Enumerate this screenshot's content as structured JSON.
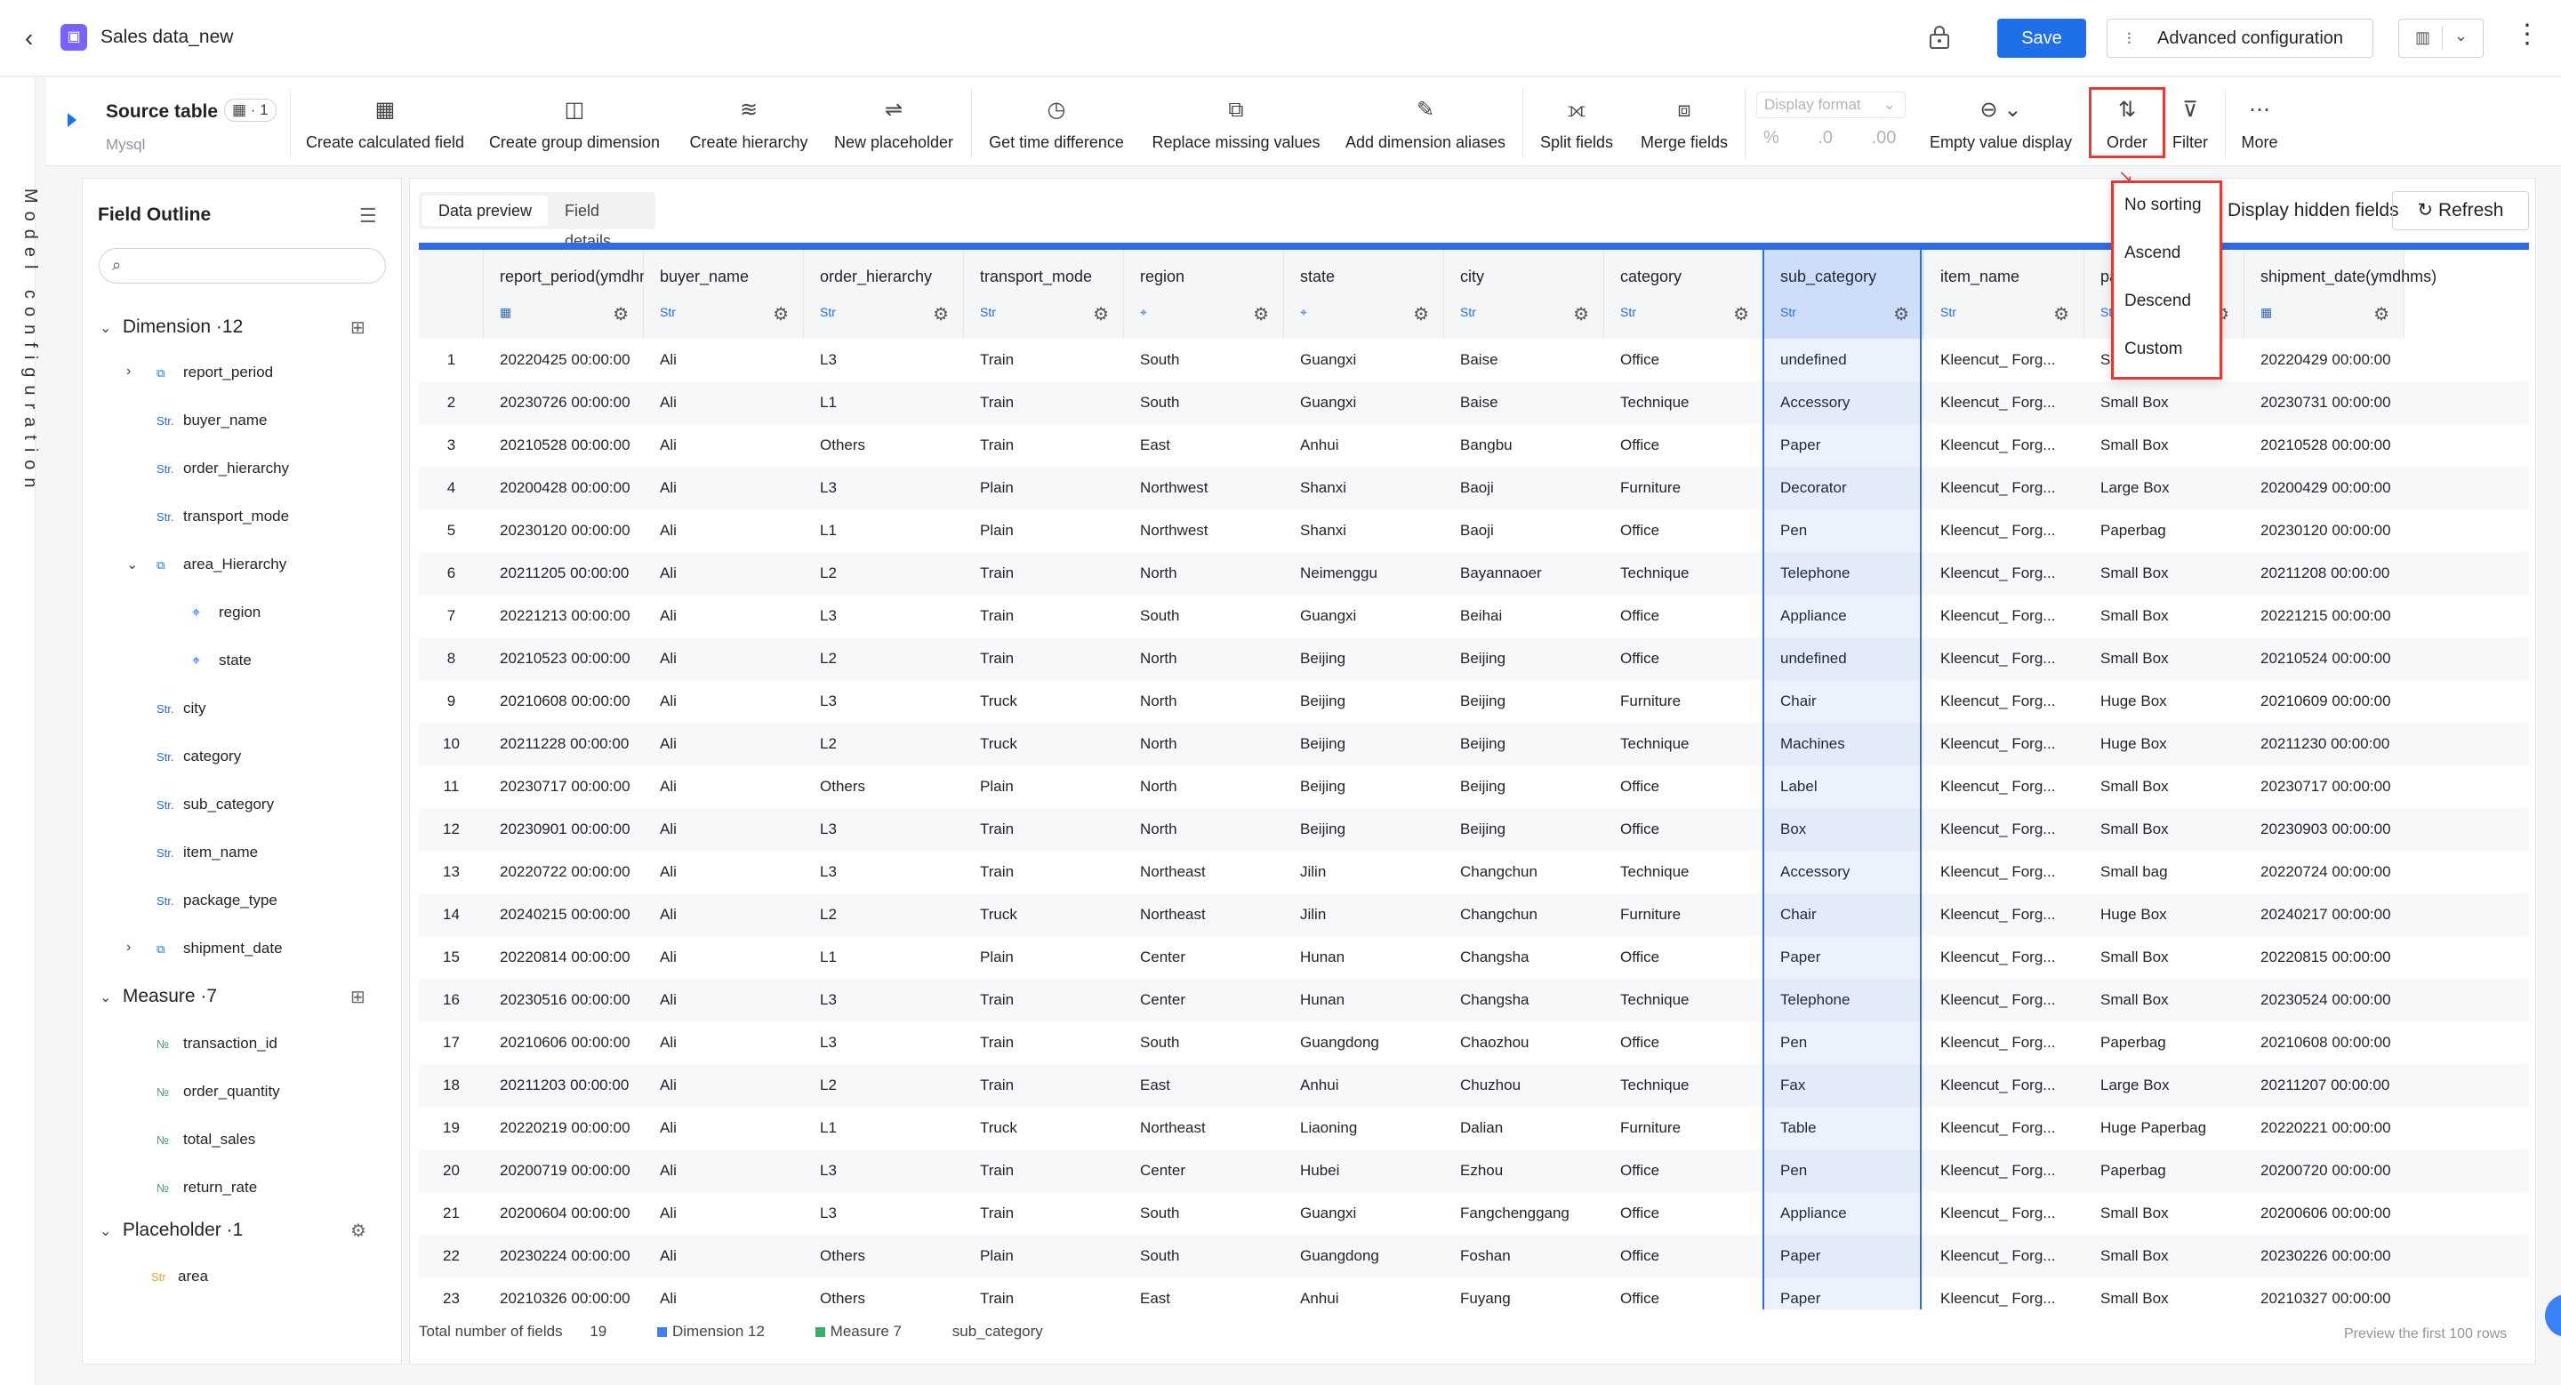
{
  "header": {
    "title": "Sales data_new",
    "save_label": "Save",
    "advanced_label": "Advanced configuration"
  },
  "rail": {
    "label": "Model configuration"
  },
  "source": {
    "title": "Source table",
    "badge": "▦ · 1",
    "db": "Mysql"
  },
  "toolbar": {
    "tools": [
      {
        "label": "Create calculated field",
        "icon": "▦"
      },
      {
        "label": "Create group dimension",
        "icon": "◫"
      },
      {
        "label": "Create hierarchy",
        "icon": "≋"
      },
      {
        "label": "New placeholder",
        "icon": "⇌"
      },
      {
        "label": "Get time difference",
        "icon": "◷"
      },
      {
        "label": "Replace missing values",
        "icon": "⧉"
      },
      {
        "label": "Add dimension aliases",
        "icon": "✎"
      },
      {
        "label": "Split fields",
        "icon": "⟗"
      },
      {
        "label": "Merge fields",
        "icon": "⧈"
      },
      {
        "label": "Empty value display",
        "icon": "⊖ ⌄"
      },
      {
        "label": "Order",
        "icon": "⇅"
      },
      {
        "label": "Filter",
        "icon": "⊽"
      },
      {
        "label": "More",
        "icon": "⋯"
      }
    ],
    "display_format": "Display format",
    "format_icons": [
      "%",
      ".0",
      ".00"
    ]
  },
  "sidebar": {
    "title": "Field Outline",
    "search_placeholder": "",
    "dimension_label": "Dimension",
    "dimension_count": "·12",
    "measure_label": "Measure",
    "measure_count": "·7",
    "placeholder_label": "Placeholder",
    "placeholder_count": "·1",
    "dimension_fields": [
      {
        "name": "report_period",
        "type": "hier"
      },
      {
        "name": "buyer_name",
        "type": "str"
      },
      {
        "name": "order_hierarchy",
        "type": "str"
      },
      {
        "name": "transport_mode",
        "type": "str"
      },
      {
        "name": "area_Hierarchy",
        "type": "hier"
      },
      {
        "name": "region",
        "type": "geo"
      },
      {
        "name": "state",
        "type": "geo"
      },
      {
        "name": "city",
        "type": "str"
      },
      {
        "name": "category",
        "type": "str"
      },
      {
        "name": "sub_category",
        "type": "str"
      },
      {
        "name": "item_name",
        "type": "str"
      },
      {
        "name": "package_type",
        "type": "str"
      },
      {
        "name": "shipment_date",
        "type": "hier"
      }
    ],
    "measure_fields": [
      "transaction_id",
      "order_quantity",
      "total_sales",
      "return_rate"
    ],
    "placeholder_fields": [
      "area"
    ],
    "type_labels": {
      "str": "Str.",
      "num": "№",
      "ph": "Str"
    }
  },
  "main": {
    "tab_preview": "Data preview",
    "tab_details": "Field details",
    "show_hidden": "Display hidden fields",
    "refresh": "Refresh"
  },
  "table": {
    "columns": [
      {
        "name": "report_period(ymdhms)",
        "type": "date"
      },
      {
        "name": "buyer_name",
        "type": "Str"
      },
      {
        "name": "order_hierarchy",
        "type": "Str"
      },
      {
        "name": "transport_mode",
        "type": "Str"
      },
      {
        "name": "region",
        "type": "geo"
      },
      {
        "name": "state",
        "type": "geo"
      },
      {
        "name": "city",
        "type": "Str"
      },
      {
        "name": "category",
        "type": "Str"
      },
      {
        "name": "sub_category",
        "type": "Str"
      },
      {
        "name": "item_name",
        "type": "Str"
      },
      {
        "name": "package_type",
        "type": "Str"
      },
      {
        "name": "shipment_date(ymdhms)",
        "type": "date"
      }
    ],
    "rows": [
      [
        "20220425 00:00:00",
        "Ali",
        "L3",
        "Train",
        "South",
        "Guangxi",
        "Baise",
        "Office",
        "undefined",
        "Kleencut_ Forg...",
        "Small Box",
        "20220429 00:00:00"
      ],
      [
        "20230726 00:00:00",
        "Ali",
        "L1",
        "Train",
        "South",
        "Guangxi",
        "Baise",
        "Technique",
        "Accessory",
        "Kleencut_ Forg...",
        "Small Box",
        "20230731 00:00:00"
      ],
      [
        "20210528 00:00:00",
        "Ali",
        "Others",
        "Train",
        "East",
        "Anhui",
        "Bangbu",
        "Office",
        "Paper",
        "Kleencut_ Forg...",
        "Small Box",
        "20210528 00:00:00"
      ],
      [
        "20200428 00:00:00",
        "Ali",
        "L3",
        "Plain",
        "Northwest",
        "Shanxi",
        "Baoji",
        "Furniture",
        "Decorator",
        "Kleencut_ Forg...",
        "Large Box",
        "20200429 00:00:00"
      ],
      [
        "20230120 00:00:00",
        "Ali",
        "L1",
        "Plain",
        "Northwest",
        "Shanxi",
        "Baoji",
        "Office",
        "Pen",
        "Kleencut_ Forg...",
        "Paperbag",
        "20230120 00:00:00"
      ],
      [
        "20211205 00:00:00",
        "Ali",
        "L2",
        "Train",
        "North",
        "Neimenggu",
        "Bayannaoer",
        "Technique",
        "Telephone",
        "Kleencut_ Forg...",
        "Small Box",
        "20211208 00:00:00"
      ],
      [
        "20221213 00:00:00",
        "Ali",
        "L3",
        "Train",
        "South",
        "Guangxi",
        "Beihai",
        "Office",
        "Appliance",
        "Kleencut_ Forg...",
        "Small Box",
        "20221215 00:00:00"
      ],
      [
        "20210523 00:00:00",
        "Ali",
        "L2",
        "Train",
        "North",
        "Beijing",
        "Beijing",
        "Office",
        "undefined",
        "Kleencut_ Forg...",
        "Small Box",
        "20210524 00:00:00"
      ],
      [
        "20210608 00:00:00",
        "Ali",
        "L3",
        "Truck",
        "North",
        "Beijing",
        "Beijing",
        "Furniture",
        "Chair",
        "Kleencut_ Forg...",
        "Huge Box",
        "20210609 00:00:00"
      ],
      [
        "20211228 00:00:00",
        "Ali",
        "L2",
        "Truck",
        "North",
        "Beijing",
        "Beijing",
        "Technique",
        "Machines",
        "Kleencut_ Forg...",
        "Huge Box",
        "20211230 00:00:00"
      ],
      [
        "20230717 00:00:00",
        "Ali",
        "Others",
        "Plain",
        "North",
        "Beijing",
        "Beijing",
        "Office",
        "Label",
        "Kleencut_ Forg...",
        "Small Box",
        "20230717 00:00:00"
      ],
      [
        "20230901 00:00:00",
        "Ali",
        "L3",
        "Train",
        "North",
        "Beijing",
        "Beijing",
        "Office",
        "Box",
        "Kleencut_ Forg...",
        "Small Box",
        "20230903 00:00:00"
      ],
      [
        "20220722 00:00:00",
        "Ali",
        "L3",
        "Train",
        "Northeast",
        "Jilin",
        "Changchun",
        "Technique",
        "Accessory",
        "Kleencut_ Forg...",
        "Small bag",
        "20220724 00:00:00"
      ],
      [
        "20240215 00:00:00",
        "Ali",
        "L2",
        "Truck",
        "Northeast",
        "Jilin",
        "Changchun",
        "Furniture",
        "Chair",
        "Kleencut_ Forg...",
        "Huge Box",
        "20240217 00:00:00"
      ],
      [
        "20220814 00:00:00",
        "Ali",
        "L1",
        "Plain",
        "Center",
        "Hunan",
        "Changsha",
        "Office",
        "Paper",
        "Kleencut_ Forg...",
        "Small Box",
        "20220815 00:00:00"
      ],
      [
        "20230516 00:00:00",
        "Ali",
        "L3",
        "Train",
        "Center",
        "Hunan",
        "Changsha",
        "Technique",
        "Telephone",
        "Kleencut_ Forg...",
        "Small Box",
        "20230524 00:00:00"
      ],
      [
        "20210606 00:00:00",
        "Ali",
        "L3",
        "Train",
        "South",
        "Guangdong",
        "Chaozhou",
        "Office",
        "Pen",
        "Kleencut_ Forg...",
        "Paperbag",
        "20210608 00:00:00"
      ],
      [
        "20211203 00:00:00",
        "Ali",
        "L2",
        "Train",
        "East",
        "Anhui",
        "Chuzhou",
        "Technique",
        "Fax",
        "Kleencut_ Forg...",
        "Large Box",
        "20211207 00:00:00"
      ],
      [
        "20220219 00:00:00",
        "Ali",
        "L1",
        "Truck",
        "Northeast",
        "Liaoning",
        "Dalian",
        "Furniture",
        "Table",
        "Kleencut_ Forg...",
        "Huge Paperbag",
        "20220221 00:00:00"
      ],
      [
        "20200719 00:00:00",
        "Ali",
        "L3",
        "Train",
        "Center",
        "Hubei",
        "Ezhou",
        "Office",
        "Pen",
        "Kleencut_ Forg...",
        "Paperbag",
        "20200720 00:00:00"
      ],
      [
        "20200604 00:00:00",
        "Ali",
        "L3",
        "Train",
        "South",
        "Guangxi",
        "Fangchenggang",
        "Office",
        "Appliance",
        "Kleencut_ Forg...",
        "Small Box",
        "20200606 00:00:00"
      ],
      [
        "20230224 00:00:00",
        "Ali",
        "Others",
        "Plain",
        "South",
        "Guangdong",
        "Foshan",
        "Office",
        "Paper",
        "Kleencut_ Forg...",
        "Small Box",
        "20230226 00:00:00"
      ],
      [
        "20210326 00:00:00",
        "Ali",
        "Others",
        "Train",
        "East",
        "Anhui",
        "Fuyang",
        "Office",
        "Paper",
        "Kleencut_ Forg...",
        "Small Box",
        "20210327 00:00:00"
      ]
    ]
  },
  "footer": {
    "total_label": "Total number of fields",
    "total_value": "19",
    "dimension": "Dimension 12",
    "measure": "Measure 7",
    "selected": "sub_category",
    "preview_note": "Preview the first 100 rows"
  },
  "order_menu": {
    "items": [
      "No sorting",
      "Ascend",
      "Descend",
      "Custom"
    ]
  },
  "colors": {
    "accent": "#1f6feb",
    "highlight": "#e53935",
    "dimension": "#3b82f6",
    "measure": "#2fb36a"
  }
}
